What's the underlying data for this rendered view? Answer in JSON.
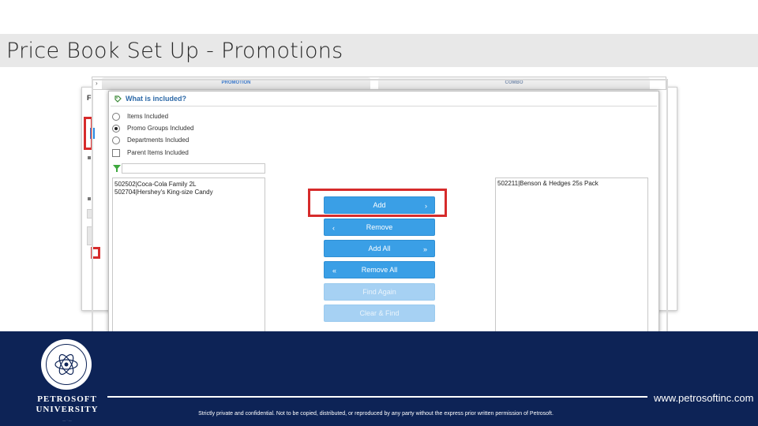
{
  "slide": {
    "title": "Price Book Set Up - Promotions"
  },
  "tabs": {
    "promotion": "PROMOTION",
    "combo": "COMBO",
    "bg_form_initial": "F"
  },
  "dialog": {
    "title": "What is included?",
    "options": [
      {
        "label": "Items Included",
        "type": "radio",
        "selected": false
      },
      {
        "label": "Promo Groups Included",
        "type": "radio",
        "selected": true
      },
      {
        "label": "Departments Included",
        "type": "radio",
        "selected": false
      },
      {
        "label": "Parent Items Included",
        "type": "checkbox",
        "selected": false
      }
    ],
    "filter_value": "",
    "available_items": [
      "502502|Coca-Cola Family 2L",
      "502704|Hershey's King-size Candy"
    ],
    "selected_items": [
      "502211|Benson & Hedges 25s Pack"
    ],
    "buttons": {
      "add": "Add",
      "remove": "Remove",
      "add_all": "Add All",
      "remove_all": "Remove All",
      "find_again": "Find Again",
      "clear_find": "Clear & Find"
    }
  },
  "footer": {
    "logo_line1": "PETROSOFT",
    "logo_line2": "UNIVERSITY",
    "disclaimer": "Strictly private and confidential. Not to be copied, distributed, or reproduced by any party without the express prior written permission of Petrosoft.",
    "website": "www.petrosoftinc.com"
  },
  "colors": {
    "footer_bg": "#0d2356",
    "button_blue": "#3a9fe6",
    "highlight_red": "#d62b2b"
  },
  "icons": {
    "header": "tag-icon",
    "filter": "filter-icon"
  }
}
